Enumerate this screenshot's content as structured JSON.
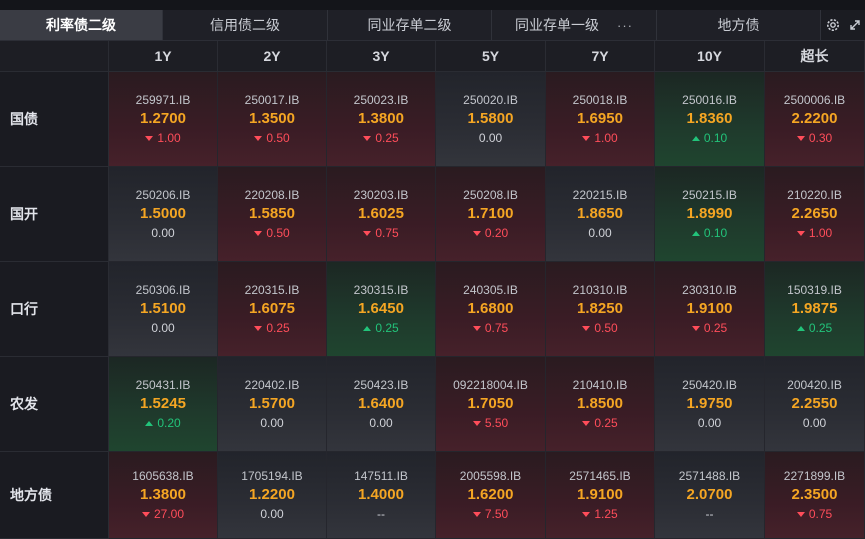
{
  "tabs": [
    {
      "label": "利率债二级",
      "active": true
    },
    {
      "label": "信用债二级",
      "active": false
    },
    {
      "label": "同业存单二级",
      "active": false
    },
    {
      "label": "同业存单一级",
      "active": false,
      "more": "···"
    },
    {
      "label": "地方债",
      "active": false
    }
  ],
  "columns": [
    "1Y",
    "2Y",
    "3Y",
    "5Y",
    "7Y",
    "10Y",
    "超长"
  ],
  "rows": [
    {
      "name": "国债",
      "cells": [
        {
          "code": "259971.IB",
          "yield": "1.2700",
          "change": "1.00",
          "dir": "up"
        },
        {
          "code": "250017.IB",
          "yield": "1.3500",
          "change": "0.50",
          "dir": "up"
        },
        {
          "code": "250023.IB",
          "yield": "1.3800",
          "change": "0.25",
          "dir": "up"
        },
        {
          "code": "250020.IB",
          "yield": "1.5800",
          "change": "0.00",
          "dir": "flat"
        },
        {
          "code": "250018.IB",
          "yield": "1.6950",
          "change": "1.00",
          "dir": "up"
        },
        {
          "code": "250016.IB",
          "yield": "1.8360",
          "change": "0.10",
          "dir": "down"
        },
        {
          "code": "2500006.IB",
          "yield": "2.2200",
          "change": "0.30",
          "dir": "up"
        }
      ]
    },
    {
      "name": "国开",
      "cells": [
        {
          "code": "250206.IB",
          "yield": "1.5000",
          "change": "0.00",
          "dir": "flat"
        },
        {
          "code": "220208.IB",
          "yield": "1.5850",
          "change": "0.50",
          "dir": "up"
        },
        {
          "code": "230203.IB",
          "yield": "1.6025",
          "change": "0.75",
          "dir": "up"
        },
        {
          "code": "250208.IB",
          "yield": "1.7100",
          "change": "0.20",
          "dir": "up"
        },
        {
          "code": "220215.IB",
          "yield": "1.8650",
          "change": "0.00",
          "dir": "flat"
        },
        {
          "code": "250215.IB",
          "yield": "1.8990",
          "change": "0.10",
          "dir": "down"
        },
        {
          "code": "210220.IB",
          "yield": "2.2650",
          "change": "1.00",
          "dir": "up"
        }
      ]
    },
    {
      "name": "口行",
      "cells": [
        {
          "code": "250306.IB",
          "yield": "1.5100",
          "change": "0.00",
          "dir": "flat"
        },
        {
          "code": "220315.IB",
          "yield": "1.6075",
          "change": "0.25",
          "dir": "up"
        },
        {
          "code": "230315.IB",
          "yield": "1.6450",
          "change": "0.25",
          "dir": "down"
        },
        {
          "code": "240305.IB",
          "yield": "1.6800",
          "change": "0.75",
          "dir": "up"
        },
        {
          "code": "210310.IB",
          "yield": "1.8250",
          "change": "0.50",
          "dir": "up"
        },
        {
          "code": "230310.IB",
          "yield": "1.9100",
          "change": "0.25",
          "dir": "up"
        },
        {
          "code": "150319.IB",
          "yield": "1.9875",
          "change": "0.25",
          "dir": "down"
        }
      ]
    },
    {
      "name": "农发",
      "cells": [
        {
          "code": "250431.IB",
          "yield": "1.5245",
          "change": "0.20",
          "dir": "down"
        },
        {
          "code": "220402.IB",
          "yield": "1.5700",
          "change": "0.00",
          "dir": "flat"
        },
        {
          "code": "250423.IB",
          "yield": "1.6400",
          "change": "0.00",
          "dir": "flat"
        },
        {
          "code": "092218004.IB",
          "yield": "1.7050",
          "change": "5.50",
          "dir": "up"
        },
        {
          "code": "210410.IB",
          "yield": "1.8500",
          "change": "0.25",
          "dir": "up"
        },
        {
          "code": "250420.IB",
          "yield": "1.9750",
          "change": "0.00",
          "dir": "flat"
        },
        {
          "code": "200420.IB",
          "yield": "2.2550",
          "change": "0.00",
          "dir": "flat"
        }
      ]
    },
    {
      "name": "地方债",
      "cells": [
        {
          "code": "1605638.IB",
          "yield": "1.3800",
          "change": "27.00",
          "dir": "up"
        },
        {
          "code": "1705194.IB",
          "yield": "1.2200",
          "change": "0.00",
          "dir": "flat"
        },
        {
          "code": "147511.IB",
          "yield": "1.4000",
          "change": "--",
          "dir": "flat"
        },
        {
          "code": "2005598.IB",
          "yield": "1.6200",
          "change": "7.50",
          "dir": "up"
        },
        {
          "code": "2571465.IB",
          "yield": "1.9100",
          "change": "1.25",
          "dir": "up"
        },
        {
          "code": "2571488.IB",
          "yield": "2.0700",
          "change": "--",
          "dir": "flat"
        },
        {
          "code": "2271899.IB",
          "yield": "2.3500",
          "change": "0.75",
          "dir": "up"
        }
      ]
    }
  ],
  "icons": {
    "settings": "gear-icon",
    "expand": "expand-icon"
  },
  "colors": {
    "yield": "#f5a623",
    "up": "#ff4d5a",
    "down": "#22c37a",
    "active_tab": "#3a3c44"
  }
}
